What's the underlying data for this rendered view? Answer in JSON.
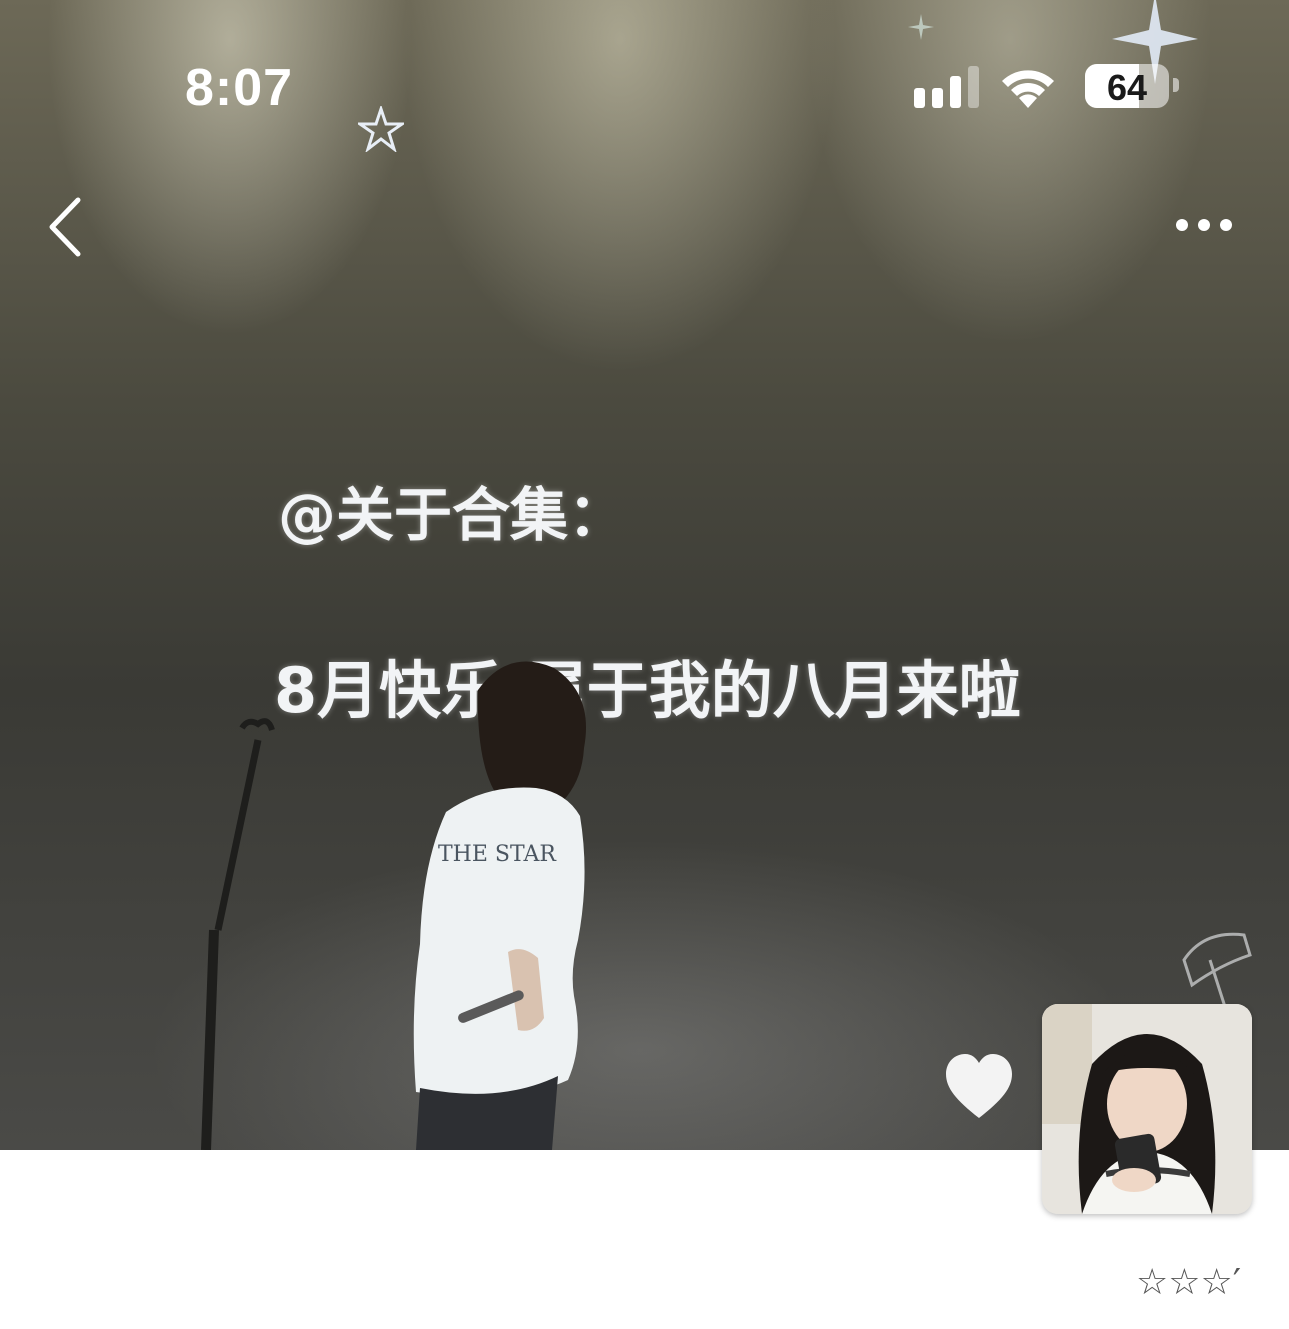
{
  "status_bar": {
    "time": "8:07",
    "battery_level": "64",
    "battery_fraction": 0.64,
    "signal_icon": "cellular-signal-icon",
    "wifi_icon": "wifi-icon"
  },
  "nav": {
    "back_icon": "chevron-left-icon",
    "more_icon": "ellipsis-icon"
  },
  "post_image": {
    "screen_text_line1": "@关于合集：",
    "screen_text_line2": "8月快乐 属于我的八月来啦",
    "shirt_text": "THE STAR",
    "heart_icon": "heart-icon"
  },
  "footer": {
    "rating_text": "☆☆☆′"
  },
  "colors": {
    "stage_dark": "#3a3a35",
    "screen_text": "#f2f4f6",
    "background": "#ffffff"
  }
}
